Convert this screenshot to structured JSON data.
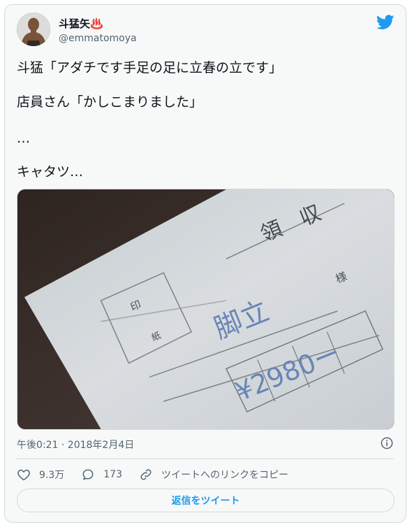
{
  "tweet": {
    "display_name": "斗猛矢♨️",
    "handle": "@emmatomoya",
    "lines": [
      "斗猛「アダチです手足の足に立春の立です」",
      "店員さん「かしこまりました」",
      "…",
      "キャタツ…"
    ],
    "timestamp": "午後0:21 · 2018年2月4日"
  },
  "photo": {
    "heading": "領　収",
    "stamp_label_top": "印",
    "stamp_label_bottom": "紙",
    "sama": "様",
    "written_name": "脚立",
    "amount": "¥2980ー"
  },
  "actions": {
    "likes": "9.3万",
    "replies": "173",
    "copy_link": "ツイートへのリンクをコピー"
  },
  "reply_button": "返信をツイート",
  "colors": {
    "accent": "#1d9bf0",
    "secondary_text": "#536471",
    "border": "#cfd9de"
  }
}
